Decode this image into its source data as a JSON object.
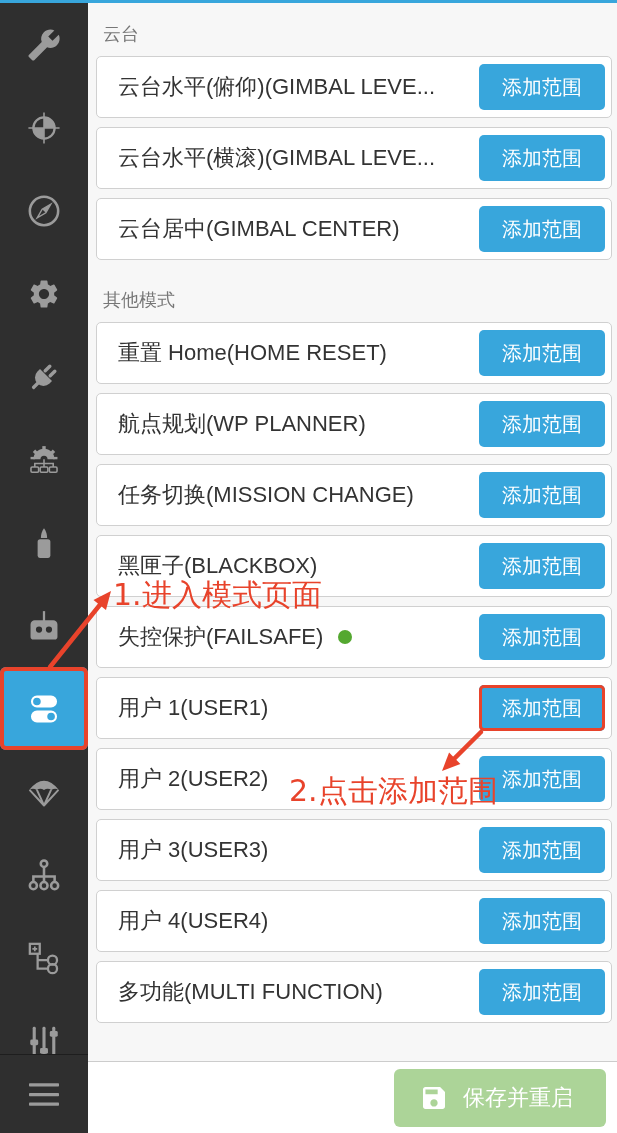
{
  "sidebar": {
    "items": [
      {
        "selected": false,
        "highlighted": false
      },
      {
        "selected": false,
        "highlighted": false
      },
      {
        "selected": false,
        "highlighted": false
      },
      {
        "selected": false,
        "highlighted": false
      },
      {
        "selected": false,
        "highlighted": false
      },
      {
        "selected": false,
        "highlighted": false
      },
      {
        "selected": false,
        "highlighted": false
      },
      {
        "selected": false,
        "highlighted": false
      },
      {
        "selected": true,
        "highlighted": true
      },
      {
        "selected": false,
        "highlighted": false
      },
      {
        "selected": false,
        "highlighted": false
      },
      {
        "selected": false,
        "highlighted": false
      },
      {
        "selected": false,
        "highlighted": false
      }
    ]
  },
  "sections": [
    {
      "title": "云台",
      "rows": [
        {
          "label": "云台水平(俯仰)(GIMBAL LEVE...",
          "button": "添加范围",
          "active": false,
          "highlighted": false
        },
        {
          "label": "云台水平(横滚)(GIMBAL LEVE...",
          "button": "添加范围",
          "active": false,
          "highlighted": false
        },
        {
          "label": "云台居中(GIMBAL CENTER)",
          "button": "添加范围",
          "active": false,
          "highlighted": false
        }
      ]
    },
    {
      "title": "其他模式",
      "rows": [
        {
          "label": "重置 Home(HOME RESET)",
          "button": "添加范围",
          "active": false,
          "highlighted": false
        },
        {
          "label": "航点规划(WP PLANNER)",
          "button": "添加范围",
          "active": false,
          "highlighted": false
        },
        {
          "label": "任务切换(MISSION CHANGE)",
          "button": "添加范围",
          "active": false,
          "highlighted": false
        },
        {
          "label": "黑匣子(BLACKBOX)",
          "button": "添加范围",
          "active": false,
          "highlighted": false
        },
        {
          "label": "失控保护(FAILSAFE)",
          "button": "添加范围",
          "active": true,
          "highlighted": false
        },
        {
          "label": "用户 1(USER1)",
          "button": "添加范围",
          "active": false,
          "highlighted": true
        },
        {
          "label": "用户 2(USER2)",
          "button": "添加范围",
          "active": false,
          "highlighted": false
        },
        {
          "label": "用户 3(USER3)",
          "button": "添加范围",
          "active": false,
          "highlighted": false
        },
        {
          "label": "用户 4(USER4)",
          "button": "添加范围",
          "active": false,
          "highlighted": false
        },
        {
          "label": "多功能(MULTI FUNCTION)",
          "button": "添加范围",
          "active": false,
          "highlighted": false
        }
      ]
    }
  ],
  "footer": {
    "save_button": {
      "label": "保存并重启",
      "disabled": true
    }
  },
  "annotations": [
    {
      "text": "1.进入模式页面"
    },
    {
      "text": "2.点击添加范围"
    }
  ]
}
